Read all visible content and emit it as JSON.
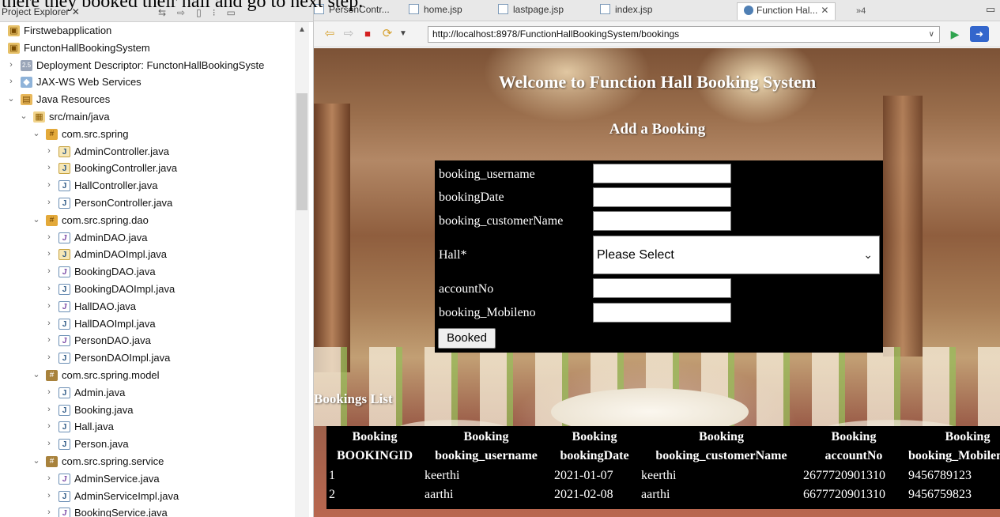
{
  "caption": "there they booked their hall and go to next step.",
  "explorer": {
    "tab_label": "Project Explorer ✕",
    "tree": [
      {
        "label": "Firstwebapplication",
        "icon": "project-icon",
        "indent": 0,
        "twisty": ""
      },
      {
        "label": "FunctonHallBookingSystem",
        "icon": "project-icon",
        "indent": 0,
        "twisty": ""
      },
      {
        "label": "Deployment Descriptor: FunctonHallBookingSyste",
        "icon": "deployment-descriptor-icon",
        "indent": 1,
        "twisty": ">"
      },
      {
        "label": "JAX-WS Web Services",
        "icon": "web-services-icon",
        "indent": 1,
        "twisty": ">"
      },
      {
        "label": "Java Resources",
        "icon": "java-resources-icon",
        "indent": 1,
        "twisty": "v"
      },
      {
        "label": "src/main/java",
        "icon": "source-folder-icon",
        "indent": 2,
        "twisty": "v"
      },
      {
        "label": "com.src.spring",
        "icon": "package-icon",
        "indent": 3,
        "twisty": "v"
      },
      {
        "label": "AdminController.java",
        "icon": "java-warning-file-icon",
        "indent": 4,
        "twisty": ">"
      },
      {
        "label": "BookingController.java",
        "icon": "java-warning-file-icon",
        "indent": 4,
        "twisty": ">"
      },
      {
        "label": "HallController.java",
        "icon": "java-file-icon",
        "indent": 4,
        "twisty": ">"
      },
      {
        "label": "PersonController.java",
        "icon": "java-file-icon",
        "indent": 4,
        "twisty": ">"
      },
      {
        "label": "com.src.spring.dao",
        "icon": "package-icon",
        "indent": 3,
        "twisty": "v"
      },
      {
        "label": "AdminDAO.java",
        "icon": "java-interface-file-icon",
        "indent": 4,
        "twisty": ">"
      },
      {
        "label": "AdminDAOImpl.java",
        "icon": "java-warning-file-icon",
        "indent": 4,
        "twisty": ">"
      },
      {
        "label": "BookingDAO.java",
        "icon": "java-interface-file-icon",
        "indent": 4,
        "twisty": ">"
      },
      {
        "label": "BookingDAOImpl.java",
        "icon": "java-file-icon",
        "indent": 4,
        "twisty": ">"
      },
      {
        "label": "HallDAO.java",
        "icon": "java-interface-file-icon",
        "indent": 4,
        "twisty": ">"
      },
      {
        "label": "HallDAOImpl.java",
        "icon": "java-file-icon",
        "indent": 4,
        "twisty": ">"
      },
      {
        "label": "PersonDAO.java",
        "icon": "java-interface-file-icon",
        "indent": 4,
        "twisty": ">"
      },
      {
        "label": "PersonDAOImpl.java",
        "icon": "java-file-icon",
        "indent": 4,
        "twisty": ">"
      },
      {
        "label": "com.src.spring.model",
        "icon": "package-empty-icon",
        "indent": 3,
        "twisty": "v"
      },
      {
        "label": "Admin.java",
        "icon": "java-file-icon",
        "indent": 4,
        "twisty": ">"
      },
      {
        "label": "Booking.java",
        "icon": "java-file-icon",
        "indent": 4,
        "twisty": ">"
      },
      {
        "label": "Hall.java",
        "icon": "java-file-icon",
        "indent": 4,
        "twisty": ">"
      },
      {
        "label": "Person.java",
        "icon": "java-file-icon",
        "indent": 4,
        "twisty": ">"
      },
      {
        "label": "com.src.spring.service",
        "icon": "package-empty-icon",
        "indent": 3,
        "twisty": "v"
      },
      {
        "label": "AdminService.java",
        "icon": "java-interface-file-icon",
        "indent": 4,
        "twisty": ">"
      },
      {
        "label": "AdminServiceImpl.java",
        "icon": "java-file-icon",
        "indent": 4,
        "twisty": ">"
      },
      {
        "label": "BookingService.java",
        "icon": "java-interface-file-icon",
        "indent": 4,
        "twisty": ">"
      }
    ]
  },
  "browser": {
    "tabs": [
      {
        "label": "PersonContr...",
        "icon": "jsp-file-icon"
      },
      {
        "label": "home.jsp",
        "icon": "jsp-file-icon"
      },
      {
        "label": "lastpage.jsp",
        "icon": "jsp-file-icon"
      },
      {
        "label": "index.jsp",
        "icon": "jsp-file-icon"
      },
      {
        "label": "Function Hal...",
        "icon": "globe-icon"
      }
    ],
    "overflow_label": "»4",
    "url": "http://localhost:8978/FunctionHallBookingSystem/bookings"
  },
  "page": {
    "welcome": "Welcome to Function Hall Booking System",
    "subtitle": "Add a Booking",
    "form": {
      "username_label": "booking_username",
      "date_label": "bookingDate",
      "customer_label": "booking_customerName",
      "hall_label": "Hall*",
      "hall_selected": "Please Select",
      "account_label": "accountNo",
      "mobile_label": "booking_Mobileno",
      "submit_label": "Booked"
    },
    "list_title": "Bookings List",
    "table": {
      "header_top": [
        "Booking",
        "Booking",
        "Booking",
        "Booking",
        "Booking",
        "Booking"
      ],
      "header_bottom": [
        "BOOKINGID",
        "booking_username",
        "bookingDate",
        "booking_customerName",
        "accountNo",
        "booking_Mobileno"
      ],
      "rows": [
        [
          "1",
          "keerthi",
          "2021-01-07",
          "keerthi",
          "2677720901310",
          "9456789123"
        ],
        [
          "2",
          "aarthi",
          "2021-02-08",
          "aarthi",
          "6677720901310",
          "9456759823"
        ]
      ]
    }
  },
  "colors": {
    "form_background": "#000000",
    "table_background": "#000000",
    "heading_text": "#ffffff"
  }
}
